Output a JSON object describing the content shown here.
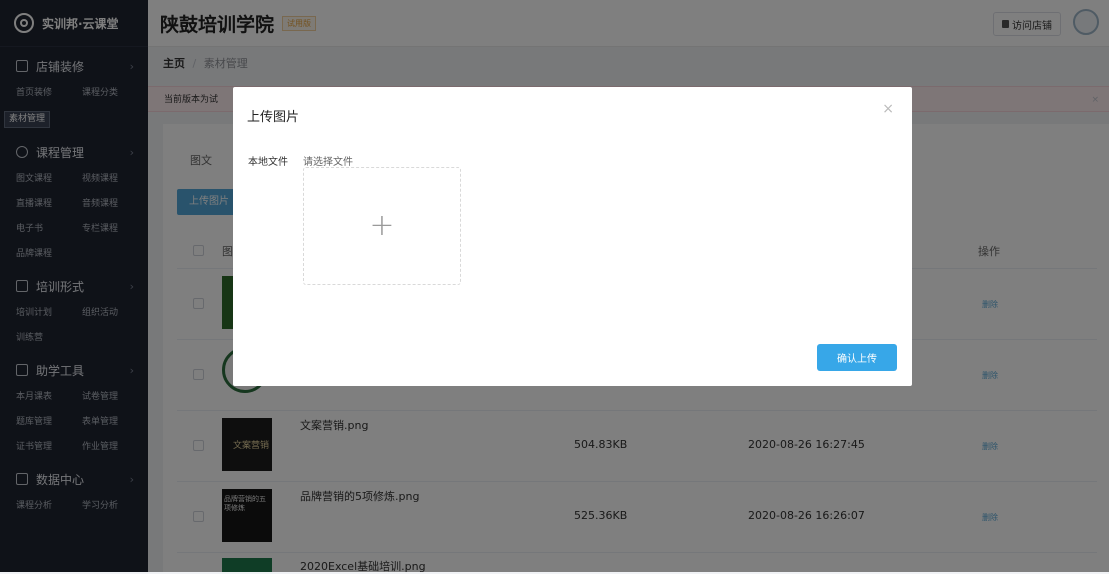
{
  "sidebar": {
    "brand": "实训邦·云课堂",
    "sections": [
      {
        "title": "店铺装修",
        "icon": "store-icon",
        "items": [
          "首页装修",
          "课程分类",
          "素材管理"
        ]
      },
      {
        "title": "课程管理",
        "icon": "course-icon",
        "items": [
          "图文课程",
          "视频课程",
          "直播课程",
          "音频课程",
          "电子书",
          "专栏课程",
          "品牌课程"
        ]
      },
      {
        "title": "培训形式",
        "icon": "training-icon",
        "items": [
          "培训计划",
          "组织活动",
          "训练营"
        ]
      },
      {
        "title": "助学工具",
        "icon": "tools-icon",
        "items": [
          "本月课表",
          "试卷管理",
          "题库管理",
          "表单管理",
          "证书管理",
          "作业管理"
        ]
      },
      {
        "title": "数据中心",
        "icon": "data-icon",
        "items": [
          "课程分析",
          "学习分析"
        ]
      }
    ],
    "active_item": "素材管理"
  },
  "topbar": {
    "shop_name": "陕鼓培训学院",
    "trial_badge": "试用版",
    "visit_store": "访问店铺"
  },
  "breadcrumb": {
    "home": "主页",
    "separator": "/",
    "current": "素材管理"
  },
  "alert": {
    "text": "当前版本为试"
  },
  "content": {
    "tab_label": "图文",
    "upload_button": "上传图片",
    "columns": {
      "image": "图",
      "action": "操作"
    },
    "rows": [
      {
        "filename": "",
        "size": "",
        "time": "",
        "action": "删除"
      },
      {
        "filename": "",
        "size": "",
        "time": "",
        "action": "删除"
      },
      {
        "filename": "文案营销.png",
        "size": "504.83KB",
        "time": "2020-08-26 16:27:45",
        "action": "删除",
        "thumb_text": "文案营销"
      },
      {
        "filename": "品牌营销的5项修炼.png",
        "size": "525.36KB",
        "time": "2020-08-26 16:26:07",
        "action": "删除",
        "thumb_text": "品牌营销的五项修炼"
      },
      {
        "filename": "2020Excel基础培训.png",
        "size": "",
        "time": "",
        "action": ""
      }
    ]
  },
  "modal": {
    "title": "上传图片",
    "close": "×",
    "field_label": "本地文件",
    "field_hint": "请选择文件",
    "dropzone_plus": "+",
    "confirm_button": "确认上传"
  },
  "colors": {
    "sidebar_bg": "#1f2430",
    "primary": "#37a7e8",
    "delete_link": "#5aa8d6",
    "alert_bg": "#fdecef"
  }
}
